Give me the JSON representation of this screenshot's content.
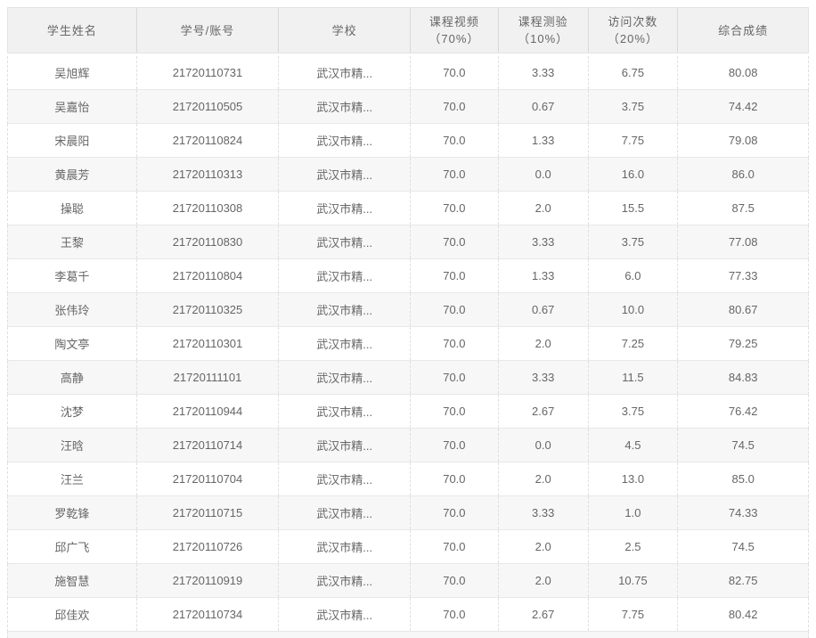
{
  "colors": {
    "header_bg": "#f1f1f1",
    "row_bg": "#ffffff",
    "row_alt_bg": "#f7f7f7",
    "text": "#666666",
    "border_solid": "#d9d9d9",
    "border_outer": "#e3e3e3",
    "border_dashed": "#dfdfdf",
    "row_border": "#e8e8e8"
  },
  "table": {
    "columns": [
      {
        "label": "学生姓名",
        "sublabel": ""
      },
      {
        "label": "学号/账号",
        "sublabel": ""
      },
      {
        "label": "学校",
        "sublabel": ""
      },
      {
        "label": "课程视频",
        "sublabel": "（70%）"
      },
      {
        "label": "课程测验",
        "sublabel": "（10%）"
      },
      {
        "label": "访问次数",
        "sublabel": "（20%）"
      },
      {
        "label": "综合成绩",
        "sublabel": ""
      }
    ],
    "rows": [
      {
        "name": "吴旭辉",
        "id": "21720110731",
        "school": "武汉市精...",
        "video": "70.0",
        "quiz": "3.33",
        "visits": "6.75",
        "score": "80.08"
      },
      {
        "name": "吴嘉怡",
        "id": "21720110505",
        "school": "武汉市精...",
        "video": "70.0",
        "quiz": "0.67",
        "visits": "3.75",
        "score": "74.42"
      },
      {
        "name": "宋晨阳",
        "id": "21720110824",
        "school": "武汉市精...",
        "video": "70.0",
        "quiz": "1.33",
        "visits": "7.75",
        "score": "79.08"
      },
      {
        "name": "黄晨芳",
        "id": "21720110313",
        "school": "武汉市精...",
        "video": "70.0",
        "quiz": "0.0",
        "visits": "16.0",
        "score": "86.0"
      },
      {
        "name": "操聪",
        "id": "21720110308",
        "school": "武汉市精...",
        "video": "70.0",
        "quiz": "2.0",
        "visits": "15.5",
        "score": "87.5"
      },
      {
        "name": "王黎",
        "id": "21720110830",
        "school": "武汉市精...",
        "video": "70.0",
        "quiz": "3.33",
        "visits": "3.75",
        "score": "77.08"
      },
      {
        "name": "李葛千",
        "id": "21720110804",
        "school": "武汉市精...",
        "video": "70.0",
        "quiz": "1.33",
        "visits": "6.0",
        "score": "77.33"
      },
      {
        "name": "张伟玲",
        "id": "21720110325",
        "school": "武汉市精...",
        "video": "70.0",
        "quiz": "0.67",
        "visits": "10.0",
        "score": "80.67"
      },
      {
        "name": "陶文亭",
        "id": "21720110301",
        "school": "武汉市精...",
        "video": "70.0",
        "quiz": "2.0",
        "visits": "7.25",
        "score": "79.25"
      },
      {
        "name": "高静",
        "id": "21720111101",
        "school": "武汉市精...",
        "video": "70.0",
        "quiz": "3.33",
        "visits": "11.5",
        "score": "84.83"
      },
      {
        "name": "沈梦",
        "id": "21720110944",
        "school": "武汉市精...",
        "video": "70.0",
        "quiz": "2.67",
        "visits": "3.75",
        "score": "76.42"
      },
      {
        "name": "汪晗",
        "id": "21720110714",
        "school": "武汉市精...",
        "video": "70.0",
        "quiz": "0.0",
        "visits": "4.5",
        "score": "74.5"
      },
      {
        "name": "汪兰",
        "id": "21720110704",
        "school": "武汉市精...",
        "video": "70.0",
        "quiz": "2.0",
        "visits": "13.0",
        "score": "85.0"
      },
      {
        "name": "罗乾锋",
        "id": "21720110715",
        "school": "武汉市精...",
        "video": "70.0",
        "quiz": "3.33",
        "visits": "1.0",
        "score": "74.33"
      },
      {
        "name": "邱广飞",
        "id": "21720110726",
        "school": "武汉市精...",
        "video": "70.0",
        "quiz": "2.0",
        "visits": "2.5",
        "score": "74.5"
      },
      {
        "name": "施智慧",
        "id": "21720110919",
        "school": "武汉市精...",
        "video": "70.0",
        "quiz": "2.0",
        "visits": "10.75",
        "score": "82.75"
      },
      {
        "name": "邱佳欢",
        "id": "21720110734",
        "school": "武汉市精...",
        "video": "70.0",
        "quiz": "2.67",
        "visits": "7.75",
        "score": "80.42"
      }
    ]
  }
}
